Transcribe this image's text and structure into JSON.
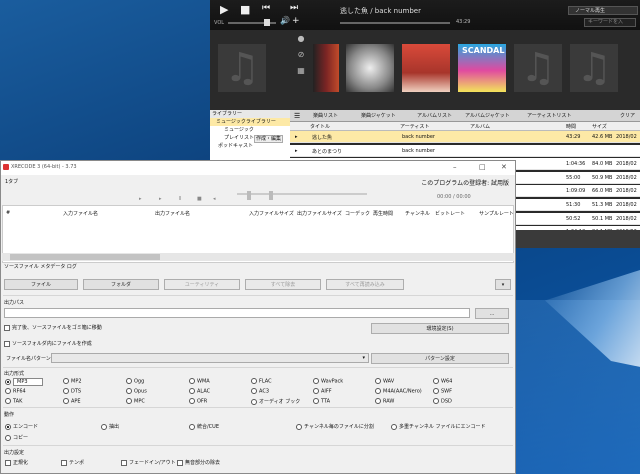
{
  "player": {
    "now_playing": "逃した魚 / back number",
    "time": "43:29",
    "vol_label": "VOL",
    "mode": "ノーマル再生",
    "search_placeholder": "キーワードを入",
    "library": {
      "header": "ライブラリー",
      "items": [
        "ミュージックライブラリー",
        "ミュージック",
        "プレイリスト",
        "ポッドキャスト"
      ],
      "edit": "作成・編集"
    },
    "tabs": [
      "楽曲リスト",
      "楽曲ジャケット",
      "アルバムリスト",
      "アルバムジャケット",
      "アーティストリスト",
      "クリア"
    ],
    "columns": [
      "タイトル",
      "アーティスト",
      "アルバム",
      "時間",
      "サイズ"
    ],
    "tracks": [
      {
        "title": "逃した魚",
        "artist": "back number",
        "time": "43:29",
        "size": "42.6 MB",
        "date": "2018/02"
      },
      {
        "title": "あとのまつり",
        "artist": "back number",
        "time": "",
        "size": "",
        "date": ""
      },
      {
        "title": "",
        "artist": "",
        "time": "1:04:36",
        "size": "84.0 MB",
        "date": "2018/02"
      },
      {
        "title": "",
        "artist": "",
        "time": "55:00",
        "size": "50.9 MB",
        "date": "2018/02"
      },
      {
        "title": "",
        "artist": "",
        "time": "1:09:09",
        "size": "66.0 MB",
        "date": "2018/02"
      },
      {
        "title": "",
        "artist": "",
        "time": "51:30",
        "size": "51.3 MB",
        "date": "2018/02"
      },
      {
        "title": "",
        "artist": "",
        "time": "50:52",
        "size": "50.1 MB",
        "date": "2018/02"
      },
      {
        "title": "",
        "artist": "",
        "time": "1:24:12",
        "size": "84.1 MB",
        "date": "2018/02"
      }
    ],
    "scandal_text": "SCANDAL"
  },
  "xr": {
    "title": "XRECODE 3 (64-bit) - 3.73",
    "menu": "1タブ",
    "registered": "このプログラムの登録者: 試用版",
    "time_display": "00:00 / 00:00",
    "columns": [
      "#",
      "入力ファイル名",
      "出力ファイル名",
      "入力ファイルサイズ",
      "出力ファイルサイズ",
      "コーデック",
      "再生時間",
      "チャンネル",
      "ビットレート",
      "サンプルレート"
    ],
    "source_tabs": "ソースファイル  メタデータ  ログ",
    "buttons": {
      "file": "ファイル",
      "folder": "フォルダ",
      "utility": "ユーティリティ",
      "clear_all": "すべて除去",
      "read_all": "すべて再読み込み",
      "browse": "...",
      "env": "環境設定(S)",
      "pattern": "パターン設定"
    },
    "output_path_label": "出力パス",
    "chk_move": "完了後、ソースファイルをゴミ箱に移動",
    "chk_mkdir": "ソースフォルダ内にファイルを作成",
    "pattern_label": "ファイル名パターン:",
    "format_label": "出力形式",
    "formats": [
      "MP3",
      "MP2",
      "Ogg",
      "WMA",
      "FLAC",
      "WavPack",
      "WAV",
      "W64",
      "RF64",
      "DTS",
      "Opus",
      "ALAC",
      "AC3",
      "AIFF",
      "M4A(AAC/Nero)",
      "SWF",
      "TAK",
      "APE",
      "MPC",
      "OFR",
      "オーディオ ブック",
      "TTA",
      "RAW",
      "DSD"
    ],
    "action_label": "動作",
    "actions": [
      "エンコード",
      "抽出",
      "統合/CUE",
      "チャンネル毎のファイルに分割",
      "多重チャンネル ファイルにエンコード",
      "コピー"
    ],
    "output_settings_label": "出力設定",
    "opts": [
      "正規化",
      "テンポ",
      "フェードイン/アウト",
      "無音部分の除去"
    ]
  }
}
